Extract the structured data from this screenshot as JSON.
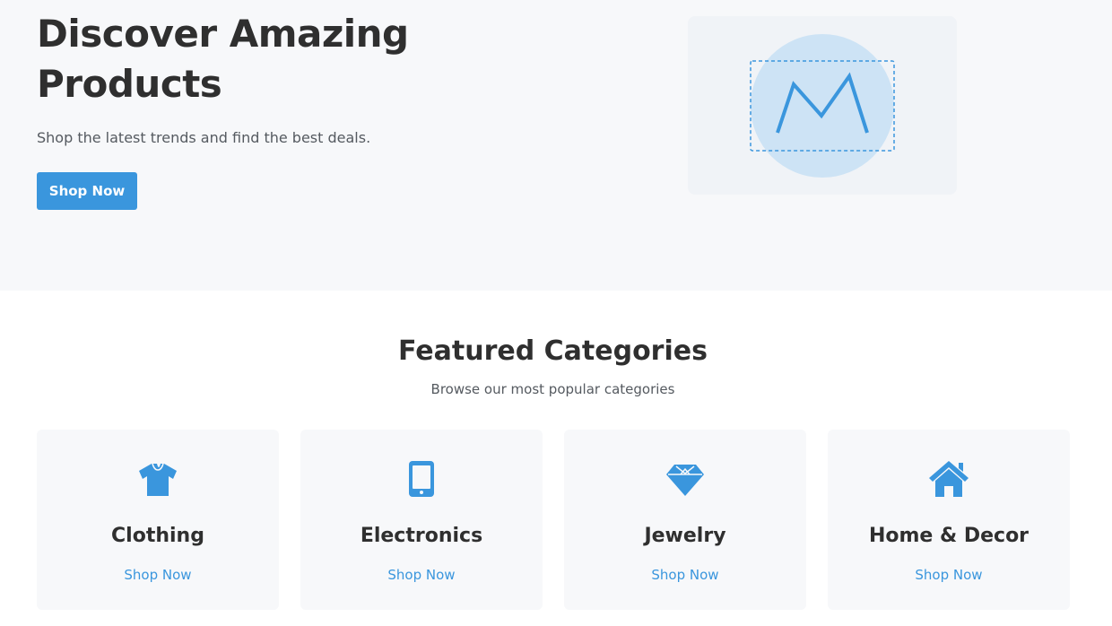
{
  "hero": {
    "title": "Discover Amazing Products",
    "subtitle": "Shop the latest trends and find the best deals.",
    "cta_label": "Shop Now",
    "image_icon": "image-placeholder-icon"
  },
  "featured": {
    "title": "Featured Categories",
    "subtitle": "Browse our most popular categories"
  },
  "categories": [
    {
      "name": "Clothing",
      "link_label": "Shop Now",
      "icon": "tshirt-icon"
    },
    {
      "name": "Electronics",
      "link_label": "Shop Now",
      "icon": "mobile-phone-icon"
    },
    {
      "name": "Jewelry",
      "link_label": "Shop Now",
      "icon": "gem-icon"
    },
    {
      "name": "Home & Decor",
      "link_label": "Shop Now",
      "icon": "home-icon"
    }
  ],
  "colors": {
    "accent": "#3a96dd",
    "hero_background": "#f7f8fa",
    "card_background": "#f7f8fa",
    "heading_text": "#2f2f2f",
    "body_text": "#555a60"
  }
}
